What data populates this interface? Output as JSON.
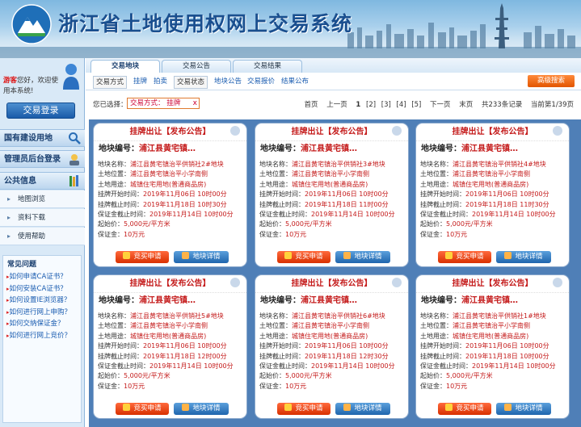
{
  "site": {
    "title": "浙江省土地使用权网上交易系统"
  },
  "left": {
    "welcome_guest": "游客",
    "welcome_text": "您好，欢迎使用本系统!",
    "login_button": "交易登录",
    "sections": [
      {
        "title": "国有建设用地",
        "icon": "search-icon"
      },
      {
        "title": "管理员后台登录",
        "icon": "admin-icon"
      },
      {
        "title": "公共信息",
        "icon": "books-icon"
      }
    ],
    "public_links": [
      "地图浏览",
      "资料下载",
      "使用帮助"
    ],
    "faq_title": "常见问题",
    "faq": [
      "如何申请CA证书？",
      "如何安装CA证书？",
      "如何设置IE浏览器？",
      "如何进行网上申购？",
      "如何交纳保证金？",
      "如何进行网上竞价？"
    ]
  },
  "tabs": [
    "交易地块",
    "交易公告",
    "交易结果"
  ],
  "subnav": {
    "mode_label": "交易方式",
    "modes": [
      "挂牌",
      "拍卖"
    ],
    "state_label": "交易状态",
    "states": [
      "地块公告",
      "交易报价",
      "结果公布"
    ],
    "advanced_search": "高级搜索"
  },
  "filter": {
    "selected_label": "您已选择：",
    "selected_value": "交易方式： 挂牌",
    "remove": "x"
  },
  "pager": {
    "first": "首页",
    "prev": "上一页",
    "pages": [
      "1",
      "[2]",
      "[3]",
      "[4]",
      "[5]"
    ],
    "next": "下一页",
    "last": "末页",
    "total": "共233条记录",
    "current": "当前第1/39页"
  },
  "card_labels": {
    "title": "挂牌出让【发布公告】",
    "parcel_no": "地块编号：",
    "name": "地块名称：",
    "location": "土地位置：",
    "use": "土地用途：",
    "start": "挂牌开始时间：",
    "end": "挂牌截止时间：",
    "deposit_deadline": "保证金截止时间：",
    "start_price": "起始价：",
    "deposit": "保证金：",
    "bid_button": "竞买申请",
    "detail_button": "地块详情"
  },
  "cards": [
    {
      "parcel_no": "浦江县黄宅镇…",
      "name": "浦江县黄宅镇治平供销社2#地块",
      "location": "浦江县黄宅镇治平小学南侧",
      "use": "城镇住宅用地(普通商品房)",
      "start": "2019年11月06日 10时00分",
      "end": "2019年11月18日 10时30分",
      "deposit_deadline": "2019年11月14日 10时00分",
      "start_price": "5,000元/平方米",
      "deposit": "10万元"
    },
    {
      "parcel_no": "浦江县黄宅镇…",
      "name": "浦江县黄宅镇治平供销社3#地块",
      "location": "浦江县黄宅镇治平小学南侧",
      "use": "城镇住宅用地(普通商品房)",
      "start": "2019年11月06日 10时00分",
      "end": "2019年11月18日 11时00分",
      "deposit_deadline": "2019年11月14日 10时00分",
      "start_price": "5,000元/平方米",
      "deposit": "10万元"
    },
    {
      "parcel_no": "浦江县黄宅镇…",
      "name": "浦江县黄宅镇治平供销社4#地块",
      "location": "浦江县黄宅镇治平小学南侧",
      "use": "城镇住宅用地(普通商品房)",
      "start": "2019年11月06日 10时00分",
      "end": "2019年11月18日 11时30分",
      "deposit_deadline": "2019年11月14日 10时00分",
      "start_price": "5,000元/平方米",
      "deposit": "10万元"
    },
    {
      "parcel_no": "浦江县黄宅镇…",
      "name": "浦江县黄宅镇治平供销社5#地块",
      "location": "浦江县黄宅镇治平小学南侧",
      "use": "城镇住宅用地(普通商品房)",
      "start": "2019年11月06日 10时00分",
      "end": "2019年11月18日 12时00分",
      "deposit_deadline": "2019年11月14日 10时00分",
      "start_price": "5,000元/平方米",
      "deposit": "10万元"
    },
    {
      "parcel_no": "浦江县黄宅镇…",
      "name": "浦江县黄宅镇治平供销社6#地块",
      "location": "浦江县黄宅镇治平小学南侧",
      "use": "城镇住宅用地(普通商品房)",
      "start": "2019年11月06日 10时00分",
      "end": "2019年11月18日 12时30分",
      "deposit_deadline": "2019年11月14日 10时00分",
      "start_price": "5,000元/平方米",
      "deposit": "10万元"
    },
    {
      "parcel_no": "浦江县黄宅镇…",
      "name": "浦江县黄宅镇治平供销社1#地块",
      "location": "浦江县黄宅镇治平小学南侧",
      "use": "城镇住宅用地(普通商品房)",
      "start": "2019年11月06日 10时00分",
      "end": "2019年11月18日 10时00分",
      "deposit_deadline": "2019年11月14日 10时00分",
      "start_price": "5,000元/平方米",
      "deposit": "10万元"
    }
  ]
}
